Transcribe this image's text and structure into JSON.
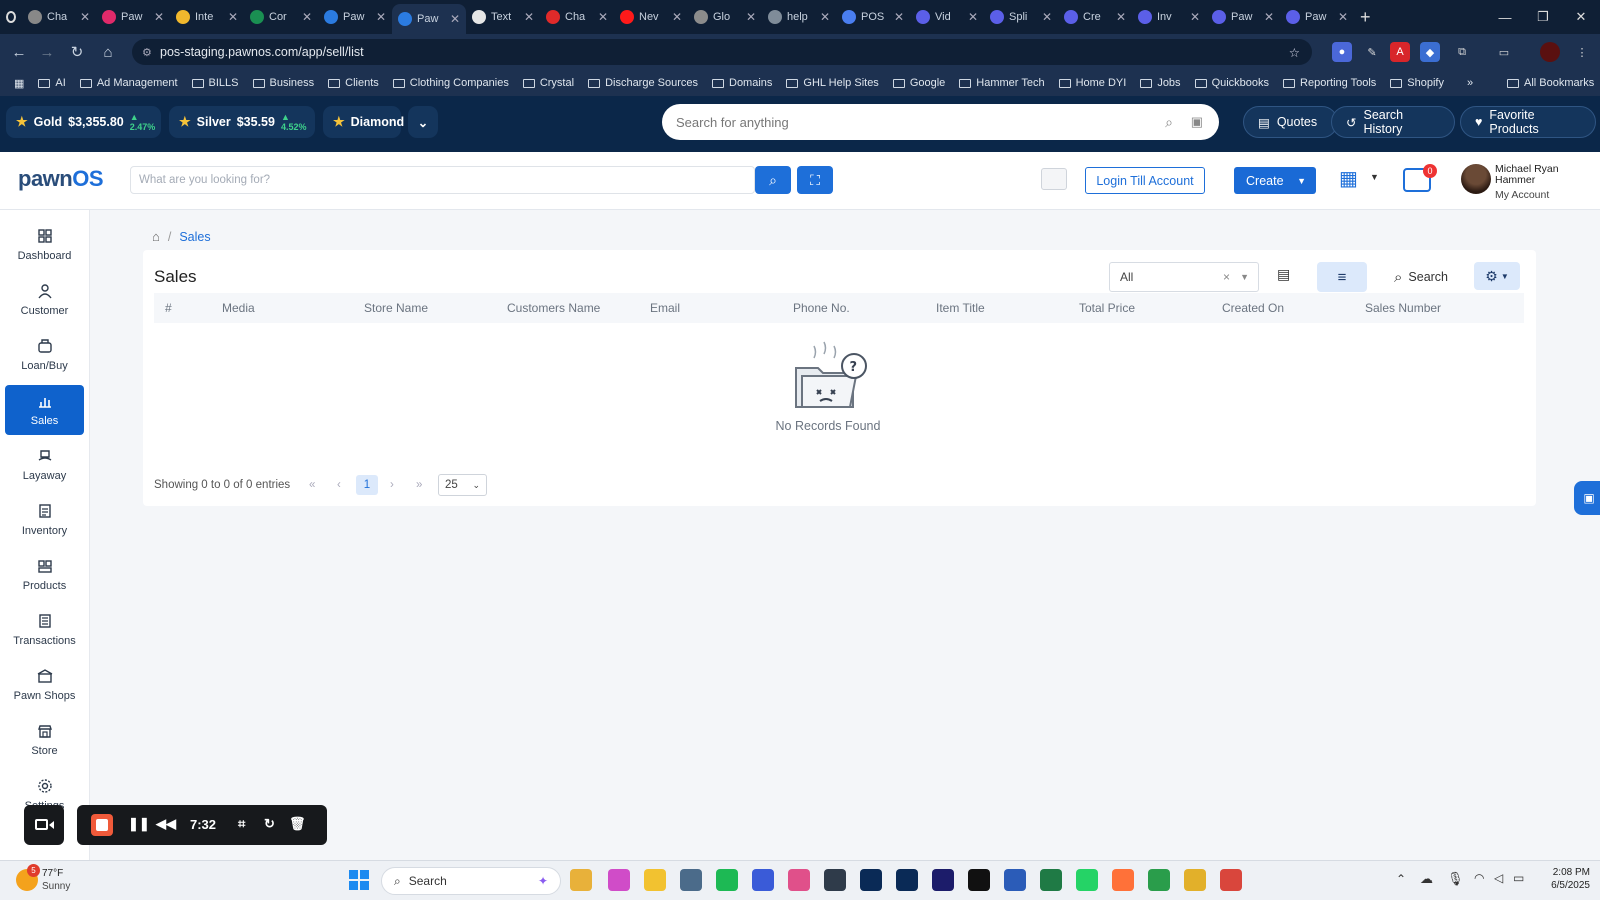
{
  "browser": {
    "tabs": [
      {
        "label": "Cha",
        "color": "#888888"
      },
      {
        "label": "Paw",
        "color": "#e02a6a"
      },
      {
        "label": "Inte",
        "color": "#f1b82d"
      },
      {
        "label": "Cor",
        "color": "#1a8f52"
      },
      {
        "label": "Paw",
        "color": "#2b7be0"
      },
      {
        "label": "Paw",
        "color": "#2b7be0"
      },
      {
        "label": "Text",
        "color": "#e6e6e6"
      },
      {
        "label": "Cha",
        "color": "#e02a2a"
      },
      {
        "label": "Nev",
        "color": "#ff1a1a"
      },
      {
        "label": "Glo",
        "color": "#8c8c8c"
      },
      {
        "label": "help",
        "color": "#7f8c99"
      },
      {
        "label": "POS",
        "color": "#4a7ef0"
      },
      {
        "label": "Vid",
        "color": "#5b5fe8"
      },
      {
        "label": "Spli",
        "color": "#5b5fe8"
      },
      {
        "label": "Cre",
        "color": "#5b5fe8"
      },
      {
        "label": "Inv",
        "color": "#5b5fe8"
      },
      {
        "label": "Paw",
        "color": "#5b5fe8"
      },
      {
        "label": "Paw",
        "color": "#5b5fe8"
      }
    ],
    "active_tab": 5,
    "url": "pos-staging.pawnos.com/app/sell/list",
    "bookmarks": [
      "AI",
      "Ad Management",
      "BILLS",
      "Business",
      "Clients",
      "Clothing Companies",
      "Crystal",
      "Discharge Sources",
      "Domains",
      "GHL Help Sites",
      "Google",
      "Hammer Tech",
      "Home DYI",
      "Jobs",
      "Quickbooks",
      "Reporting Tools",
      "Shopify"
    ],
    "all_bookmarks": "All Bookmarks",
    "more_chevron": "»"
  },
  "metals": {
    "gold": {
      "label": "Gold",
      "price": "$3,355.80",
      "change": "2.47%"
    },
    "silver": {
      "label": "Silver",
      "price": "$35.59",
      "change": "4.52%"
    },
    "diamond": {
      "label": "Diamond"
    },
    "search_placeholder": "Search for anything",
    "quotes": "Quotes",
    "search_history": "Search History",
    "favorite_products": "Favorite Products"
  },
  "app": {
    "logo_pre": "pawn",
    "logo_post": "OS",
    "search_placeholder": "What are you looking for?",
    "login_till": "Login Till Account",
    "create": "Create",
    "notif_count": "0",
    "user_name": "Michael Ryan Hammer",
    "my_account": "My Account"
  },
  "sidebar": {
    "items": [
      {
        "label": "Dashboard",
        "icon": "dashboard-icon"
      },
      {
        "label": "Customer",
        "icon": "customer-icon"
      },
      {
        "label": "Loan/Buy",
        "icon": "loan-icon"
      },
      {
        "label": "Sales",
        "icon": "sales-icon"
      },
      {
        "label": "Layaway",
        "icon": "layaway-icon"
      },
      {
        "label": "Inventory",
        "icon": "inventory-icon"
      },
      {
        "label": "Products",
        "icon": "products-icon"
      },
      {
        "label": "Transactions",
        "icon": "transactions-icon"
      },
      {
        "label": "Pawn Shops",
        "icon": "pawn-shops-icon"
      },
      {
        "label": "Store",
        "icon": "store-icon"
      },
      {
        "label": "Settings",
        "icon": "settings-icon"
      }
    ],
    "active": "Sales"
  },
  "page": {
    "breadcrumb": "Sales",
    "title": "Sales",
    "filter_value": "All",
    "search_label": "Search",
    "columns": [
      "#",
      "Media",
      "Store Name",
      "Customers Name",
      "Email",
      "Phone No.",
      "Item Title",
      "Total Price",
      "Created On",
      "Sales Number"
    ],
    "empty_text": "No Records Found",
    "entries_text": "Showing 0 to 0 of 0 entries",
    "current_page": "1",
    "page_size": "25"
  },
  "recorder": {
    "time": "7:32"
  },
  "taskbar": {
    "weather_temp": "77°F",
    "weather_desc": "Sunny",
    "weather_badge": "5",
    "search": "Search",
    "time": "2:08 PM",
    "date": "6/5/2025"
  },
  "colors": {
    "brand": "#1e6fd9",
    "sidebar_active": "#0f62cc",
    "topbar": "#0b2749"
  }
}
